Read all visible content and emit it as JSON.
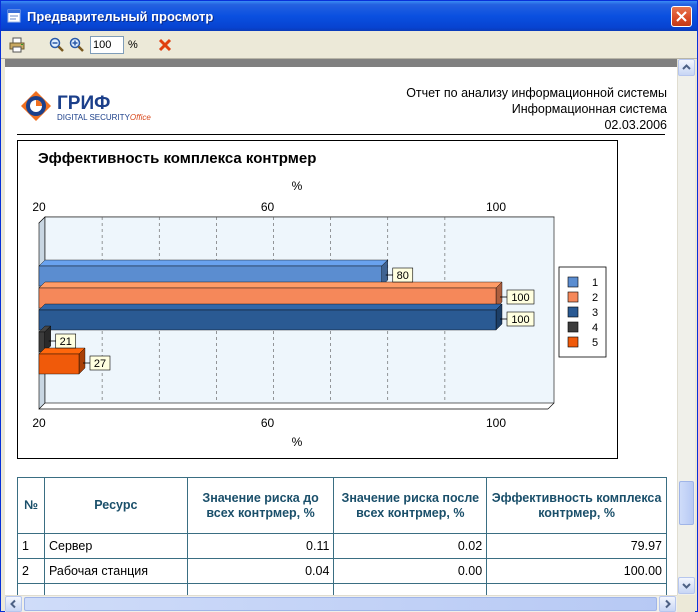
{
  "window": {
    "title": "Предварительный просмотр"
  },
  "toolbar": {
    "zoom_value": "100",
    "zoom_unit": "%",
    "icons": [
      "print-icon",
      "zoom-out-icon",
      "zoom-in-icon",
      "close-red-x-icon"
    ]
  },
  "report": {
    "logo_main": "ГРИФ",
    "logo_sub": "DIGITAL SECURITY",
    "logo_office": "Office",
    "header_line1": "Отчет по анализу информационной системы",
    "header_line2": "Информационная система",
    "header_date": "02.03.2006"
  },
  "chart_data": {
    "type": "bar",
    "orientation": "horizontal",
    "title": "Эффективность комплекса контрмер",
    "xlabel_top": "%",
    "xlabel_bottom": "%",
    "xlim": [
      20,
      100
    ],
    "ticks": [
      20,
      60,
      100
    ],
    "categories": [
      "1",
      "2",
      "3",
      "4",
      "5"
    ],
    "values": [
      80,
      100,
      100,
      21,
      27
    ],
    "colors": [
      "#5b8dd0",
      "#f5885a",
      "#2a5a93",
      "#3c3c3c",
      "#f05a0a"
    ],
    "legend": [
      "1",
      "2",
      "3",
      "4",
      "5"
    ],
    "legend_position": "right",
    "grid": true
  },
  "table": {
    "headers": [
      "№",
      "Ресурс",
      "Значение риска до всех контрмер, %",
      "Значение риска после всех контрмер, %",
      "Эффективность комплекса контрмер, %"
    ],
    "rows": [
      {
        "n": "1",
        "resource": "Сервер",
        "before": "0.11",
        "after": "0.02",
        "eff": "79.97"
      },
      {
        "n": "2",
        "resource": "Рабочая станция",
        "before": "0.04",
        "after": "0.00",
        "eff": "100.00"
      }
    ]
  }
}
